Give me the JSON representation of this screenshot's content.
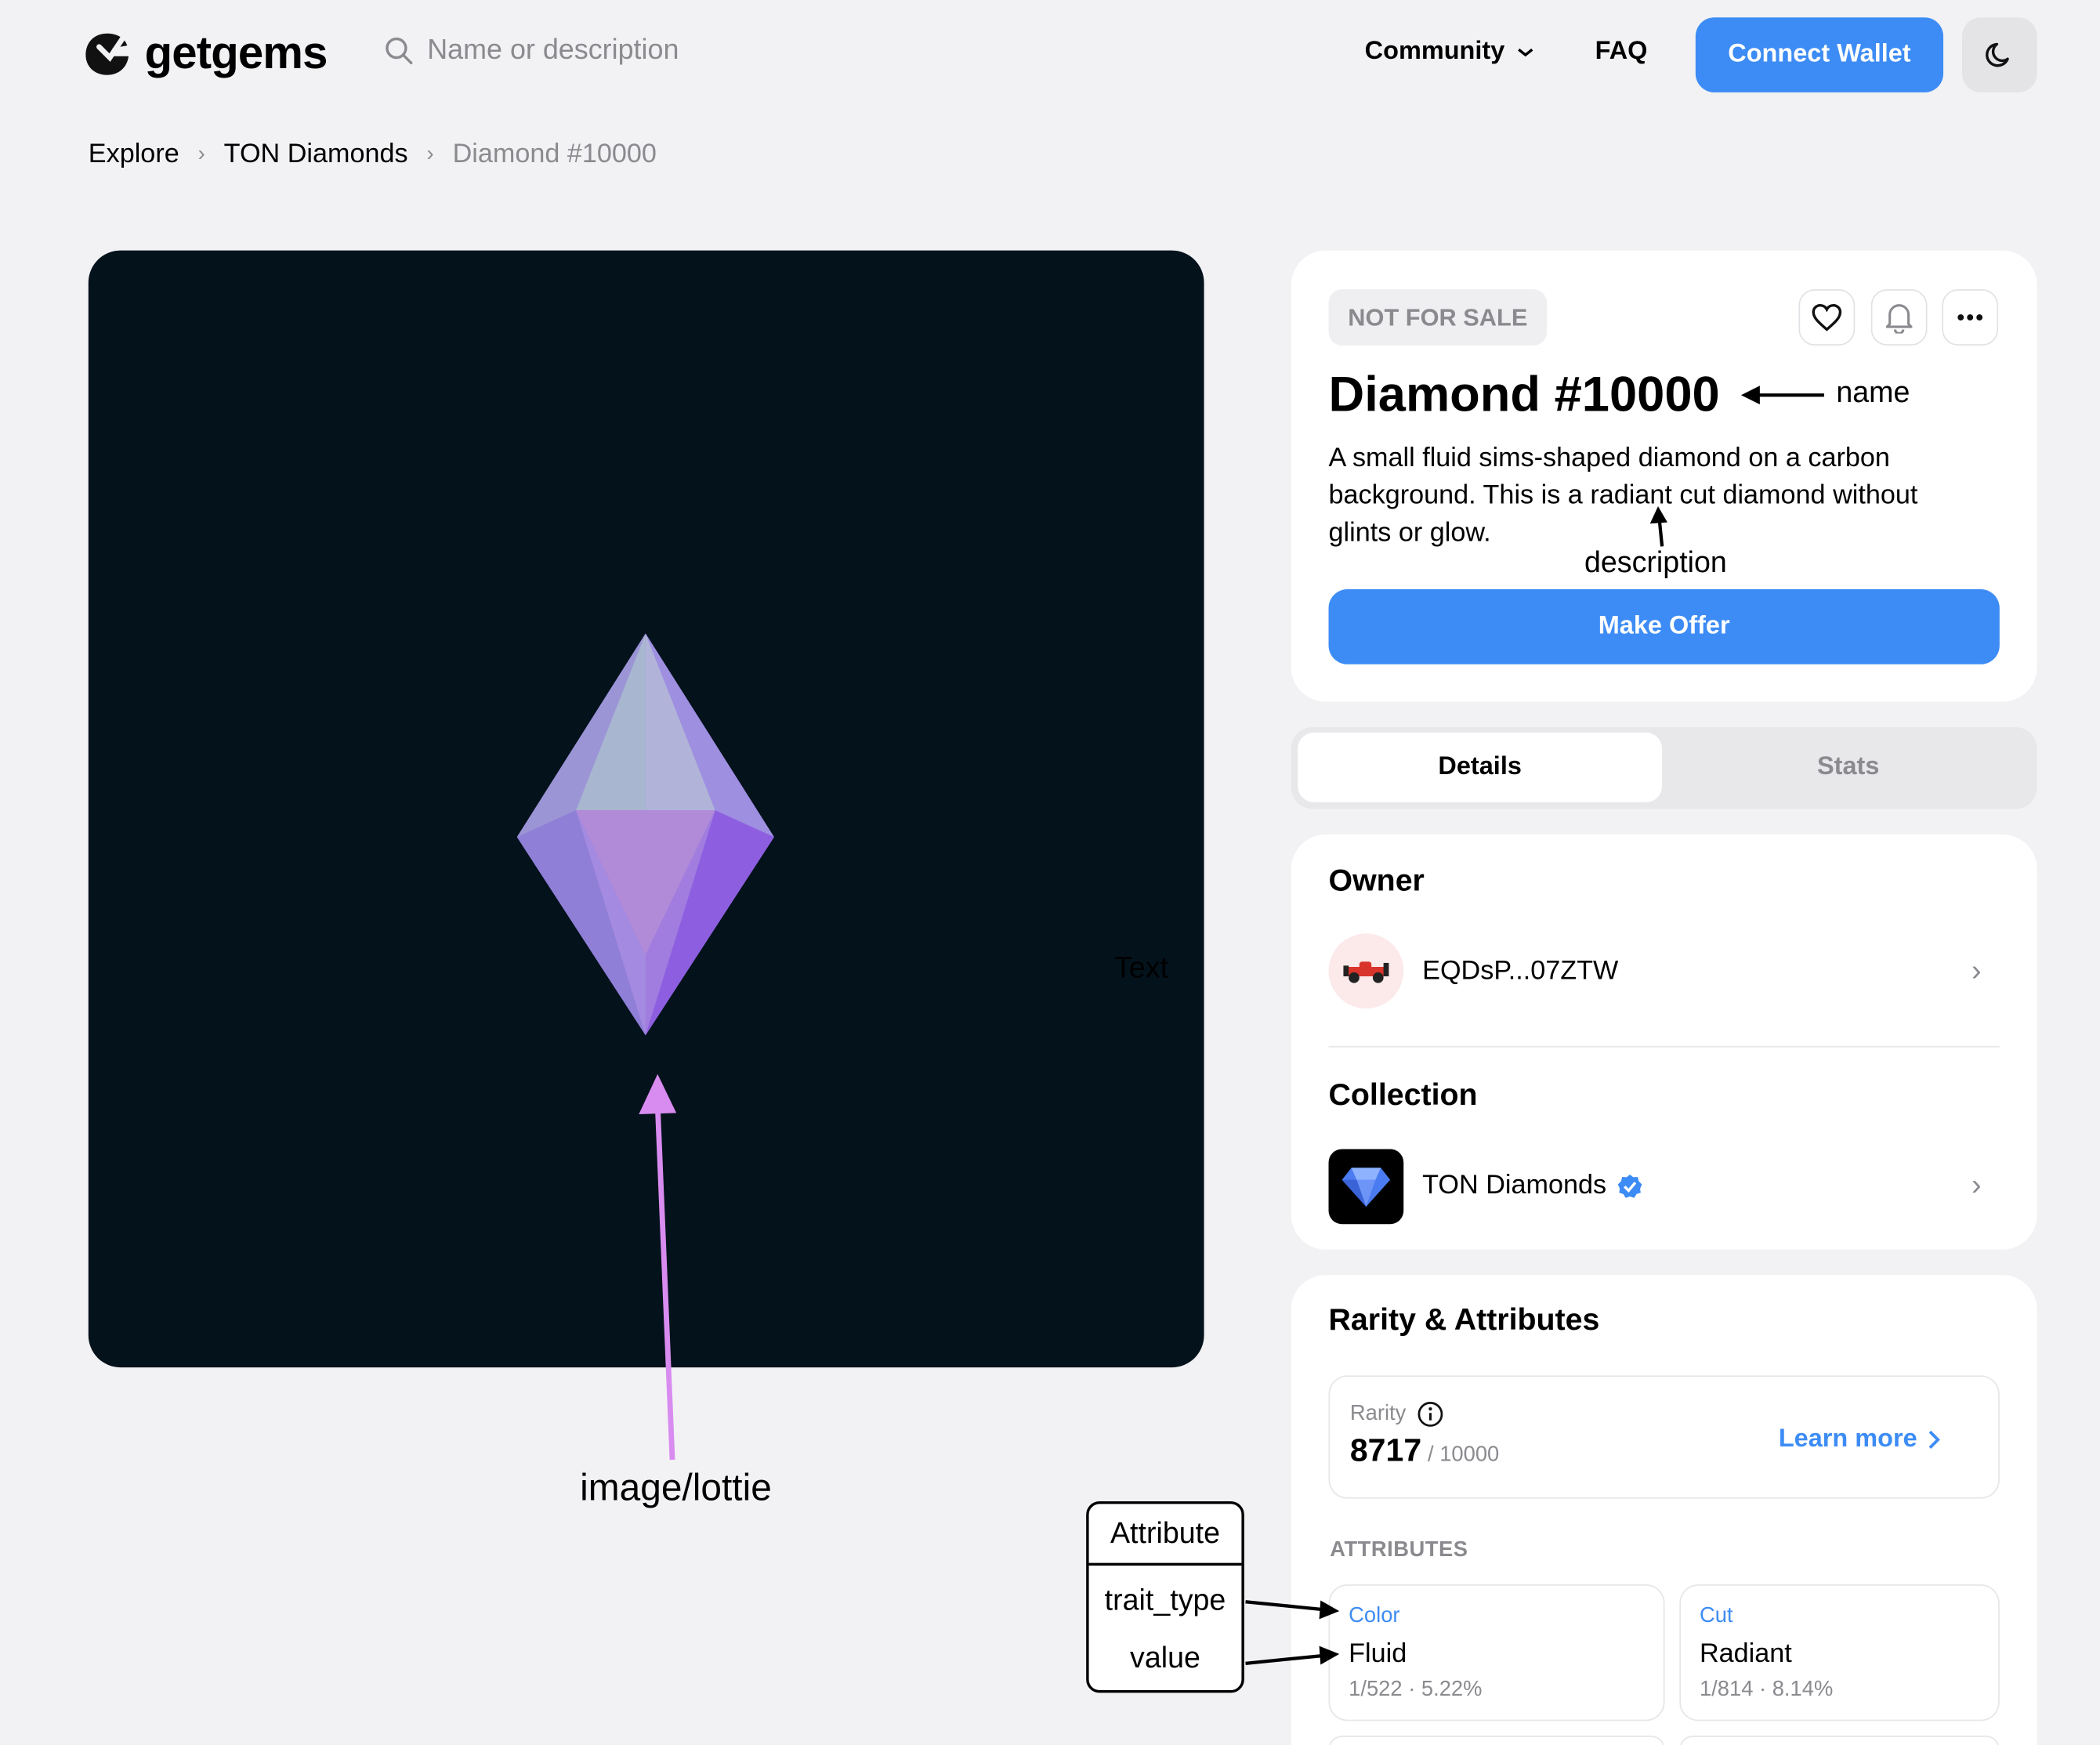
{
  "header": {
    "logo_text": "getgems",
    "search_placeholder": "Name or description",
    "nav_community": "Community",
    "nav_faq": "FAQ",
    "connect_label": "Connect Wallet"
  },
  "breadcrumb": {
    "items": [
      "Explore",
      "TON Diamonds"
    ],
    "current": "Diamond #10000"
  },
  "media": {
    "overlay_text": "Text",
    "annotation_label": "image/lottie"
  },
  "nft": {
    "status_badge": "NOT FOR SALE",
    "name": "Diamond #10000",
    "name_annotation": "name",
    "description": "A small fluid sims-shaped diamond on a carbon background. This is a radiant cut diamond without glints or glow.",
    "description_annotation": "description",
    "offer_label": "Make Offer"
  },
  "tabs": [
    "Details",
    "Stats"
  ],
  "owner": {
    "title": "Owner",
    "address": "EQDsP...07ZTW"
  },
  "collection": {
    "title": "Collection",
    "name": "TON Diamonds"
  },
  "rarity": {
    "title": "Rarity & Attributes",
    "label": "Rarity",
    "value": "8717",
    "total": "/ 10000",
    "learn_more": "Learn more",
    "attributes_heading": "ATTRIBUTES",
    "attributes": [
      {
        "trait_type": "Color",
        "value": "Fluid",
        "stat": "1/522 · 5.22%"
      },
      {
        "trait_type": "Cut",
        "value": "Radiant",
        "stat": "1/814 · 8.14%"
      }
    ]
  },
  "annotation_box": {
    "title": "Attribute",
    "row1": "trait_type",
    "row2": "value"
  },
  "colors": {
    "accent": "#3d8cf5",
    "background": "#f2f2f4",
    "media_bg": "#04121c",
    "annotation_arrow": "#d98cf0"
  }
}
